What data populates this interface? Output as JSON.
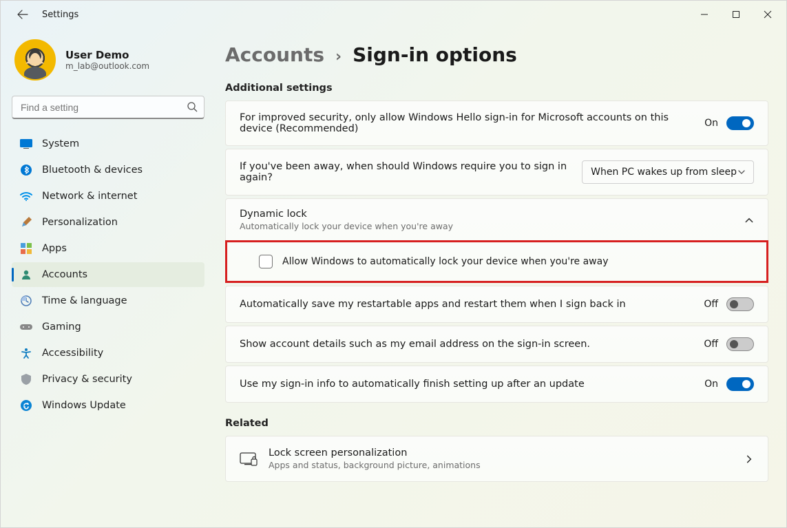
{
  "window": {
    "title": "Settings"
  },
  "user": {
    "name": "User Demo",
    "email": "m_lab@outlook.com"
  },
  "search": {
    "placeholder": "Find a setting"
  },
  "nav": {
    "items": [
      {
        "label": "System"
      },
      {
        "label": "Bluetooth & devices"
      },
      {
        "label": "Network & internet"
      },
      {
        "label": "Personalization"
      },
      {
        "label": "Apps"
      },
      {
        "label": "Accounts"
      },
      {
        "label": "Time & language"
      },
      {
        "label": "Gaming"
      },
      {
        "label": "Accessibility"
      },
      {
        "label": "Privacy & security"
      },
      {
        "label": "Windows Update"
      }
    ],
    "activeIndex": 5
  },
  "breadcrumb": {
    "parent": "Accounts",
    "current": "Sign-in options"
  },
  "sections": {
    "additional": {
      "title": "Additional settings",
      "helloOnly": {
        "text": "For improved security, only allow Windows Hello sign-in for Microsoft accounts on this device (Recommended)",
        "stateLabel": "On",
        "on": true
      },
      "requireSignin": {
        "text": "If you've been away, when should Windows require you to sign in again?",
        "selected": "When PC wakes up from sleep"
      },
      "dynamicLock": {
        "title": "Dynamic lock",
        "sub": "Automatically lock your device when you're away",
        "expanded": true,
        "checkboxLabel": "Allow Windows to automatically lock your device when you're away",
        "checked": false
      },
      "restartApps": {
        "text": "Automatically save my restartable apps and restart them when I sign back in",
        "stateLabel": "Off",
        "on": false
      },
      "accountDetails": {
        "text": "Show account details such as my email address on the sign-in screen.",
        "stateLabel": "Off",
        "on": false
      },
      "finishSetup": {
        "text": "Use my sign-in info to automatically finish setting up after an update",
        "stateLabel": "On",
        "on": true
      }
    },
    "related": {
      "title": "Related",
      "lockScreen": {
        "title": "Lock screen personalization",
        "sub": "Apps and status, background picture, animations"
      }
    }
  }
}
